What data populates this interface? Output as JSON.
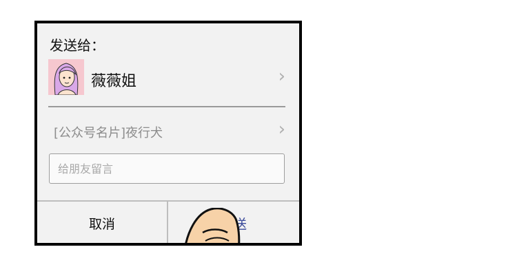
{
  "dialog": {
    "send_to_label": "发送给：",
    "recipient_name": "薇薇姐",
    "card_text": "[公众号名片]夜行犬",
    "message_placeholder": "给朋友留言",
    "cancel_label": "取消",
    "send_label": "发送"
  },
  "icons": {
    "chevron": "›",
    "avatar": "avatar-illustration",
    "finger": "pointing-finger-illustration"
  },
  "colors": {
    "panel_bg": "#f2f2f2",
    "send_text": "#3a4a9a",
    "avatar_bg": "#f6c7cf",
    "skin": "#f7d2a8"
  }
}
